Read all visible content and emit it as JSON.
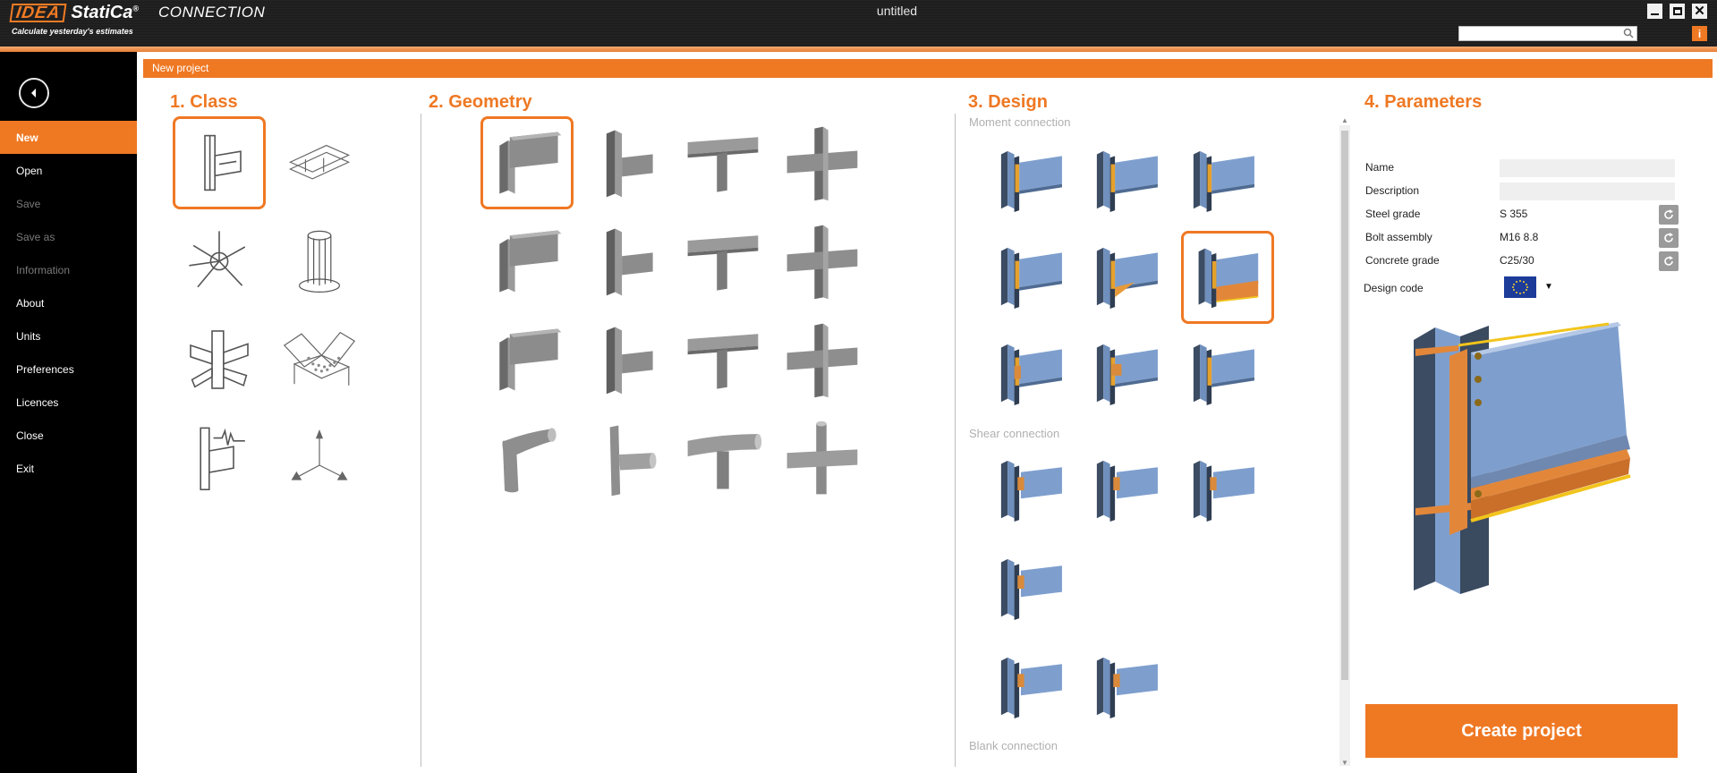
{
  "app": {
    "logo_text": "IDEA",
    "logo_product": "StatiCa",
    "registered": "®",
    "product": "CONNECTION",
    "tagline": "Calculate yesterday's estimates",
    "window_title": "untitled",
    "search_placeholder": ""
  },
  "window_controls": {
    "info_label": "i"
  },
  "sidebar": {
    "items": [
      {
        "label": "New",
        "state": "active"
      },
      {
        "label": "Open",
        "state": "normal"
      },
      {
        "label": "Save",
        "state": "disabled"
      },
      {
        "label": "Save as",
        "state": "disabled"
      },
      {
        "label": "Information",
        "state": "disabled"
      },
      {
        "label": "About",
        "state": "normal"
      },
      {
        "label": "Units",
        "state": "normal"
      },
      {
        "label": "Preferences",
        "state": "normal"
      },
      {
        "label": "Licences",
        "state": "normal"
      },
      {
        "label": "Close",
        "state": "normal"
      },
      {
        "label": "Exit",
        "state": "normal"
      }
    ]
  },
  "main": {
    "header": "New project",
    "sections": {
      "class_title": "1.  Class",
      "geometry_title": "2. Geometry",
      "design_title": "3. Design",
      "parameters_title": "4. Parameters"
    },
    "design": {
      "moment_label": "Moment connection",
      "shear_label": "Shear connection",
      "blank_label": "Blank connection"
    },
    "parameters": {
      "name_label": "Name",
      "name_value": "",
      "description_label": "Description",
      "description_value": "",
      "steel_grade_label": "Steel grade",
      "steel_grade_value": "S 355",
      "bolt_assembly_label": "Bolt assembly",
      "bolt_assembly_value": "M16 8.8",
      "concrete_grade_label": "Concrete grade",
      "concrete_grade_value": "C25/30",
      "design_code_label": "Design code",
      "design_code_value": "eu-flag-icon"
    },
    "create_button": "Create project"
  },
  "colors": {
    "accent": "#ef7823",
    "sidebar_bg": "#000000",
    "steel_blue": "#7e9fce",
    "steel_dark": "#3b4c63",
    "gray_member": "#8a8a8a"
  }
}
